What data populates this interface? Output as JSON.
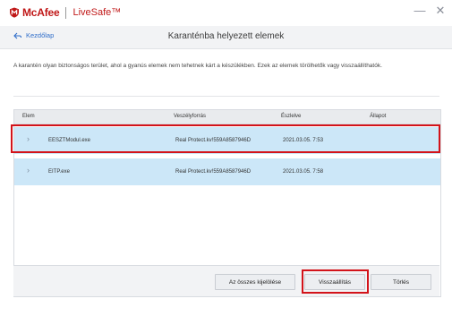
{
  "app": {
    "brand": "McAfee",
    "product": "LiveSafe™",
    "brand_color": "#c01818"
  },
  "window_controls": [
    {
      "name": "minimize-icon",
      "glyph": "—"
    },
    {
      "name": "close-icon",
      "glyph": "✕"
    }
  ],
  "header": {
    "back_label": "Kezdőlap",
    "title": "Karanténba helyezett elemek"
  },
  "description": "A karantén olyan biztonságos terület, ahol a gyanús elemek nem tehetnek kárt a készülékben. Ezek az elemek törölhetők vagy visszaállíthatók.",
  "table": {
    "columns": [
      "Elem",
      "Veszélyforrás",
      "Észlelve",
      "Állapot"
    ],
    "rows": [
      {
        "item": "EESZTModul.exe",
        "threat": "Real Protect.kv!559A8587946D",
        "detected": "2021.03.05. 7:53",
        "status": ""
      },
      {
        "item": "EITP.exe",
        "threat": "Real Protect.kv!559A8587946D",
        "detected": "2021.03.05. 7:58",
        "status": ""
      }
    ],
    "selected_color": "#cce7f8"
  },
  "buttons": {
    "select_all": "Az összes kijelölése",
    "restore": "Visszaállítás",
    "delete": "Törlés"
  },
  "highlight_color": "#d3131a"
}
